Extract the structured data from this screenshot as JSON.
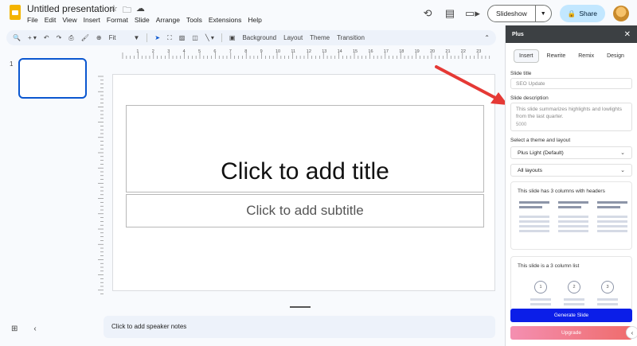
{
  "header": {
    "doc_title": "Untitled presentation",
    "menu": [
      "File",
      "Edit",
      "View",
      "Insert",
      "Format",
      "Slide",
      "Arrange",
      "Tools",
      "Extensions",
      "Help"
    ],
    "slideshow_label": "Slideshow",
    "share_label": "Share"
  },
  "toolbar": {
    "zoom_label": "Fit",
    "background_label": "Background",
    "layout_label": "Layout",
    "theme_label": "Theme",
    "transition_label": "Transition"
  },
  "filmstrip": {
    "slide_number": "1"
  },
  "ruler": {
    "ticks": [
      "1",
      "2",
      "3",
      "4",
      "5",
      "6",
      "7",
      "8",
      "9",
      "10",
      "11",
      "12",
      "13",
      "14",
      "15",
      "16",
      "17",
      "18",
      "19",
      "20",
      "21",
      "22",
      "23",
      "24",
      "25"
    ]
  },
  "slide": {
    "title_placeholder": "Click to add title",
    "subtitle_placeholder": "Click to add subtitle"
  },
  "notes": {
    "placeholder": "Click to add speaker notes"
  },
  "panel": {
    "title": "Plus",
    "tabs": [
      "Insert",
      "Rewrite",
      "Remix",
      "Design"
    ],
    "active_tab": "Insert",
    "slide_title_label": "Slide title",
    "slide_title_value": "SEO Update",
    "slide_description_label": "Slide description",
    "slide_description_value": "This slide summarizes highlights and lowlights from the last quarter.",
    "char_count": "5000",
    "theme_label": "Select a theme and layout",
    "theme_value": "Plus Light (Default)",
    "layouts_value": "All layouts",
    "layout_card_1": "This slide has 3 columns with headers",
    "layout_card_2": "This slide is a 3 column list",
    "circle_numbers": [
      "1",
      "2",
      "3"
    ],
    "generate_label": "Generate Slide",
    "upgrade_label": "Upgrade"
  },
  "colors": {
    "accent_blue": "#0b57d0",
    "generate_button": "#0b1ee8",
    "arrow_red": "#e53935",
    "share_bg": "#c2e7ff"
  }
}
